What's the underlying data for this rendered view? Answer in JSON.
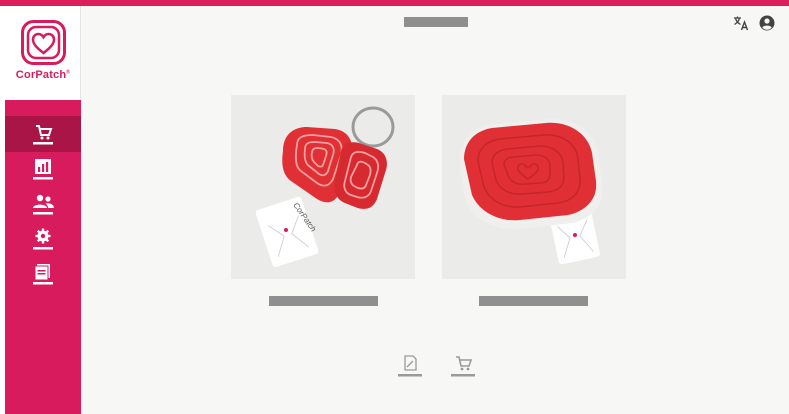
{
  "brand": {
    "name": "CorPatch",
    "trademark": "®",
    "color": "#d81b5c",
    "active_color": "#a81546"
  },
  "sidebar": {
    "items": [
      {
        "icon": "cart-icon",
        "active": true
      },
      {
        "icon": "chart-icon",
        "active": false
      },
      {
        "icon": "users-icon",
        "active": false
      },
      {
        "icon": "settings-icon",
        "active": false
      },
      {
        "icon": "document-icon",
        "active": false
      }
    ]
  },
  "header": {
    "icons": [
      "translate-icon",
      "account-icon"
    ]
  },
  "products": [
    {
      "image": "corpatch-keychain-product-image"
    },
    {
      "image": "corpatch-device-product-image"
    }
  ],
  "footer": {
    "icons": [
      "edit-document-icon",
      "cart-icon"
    ]
  }
}
